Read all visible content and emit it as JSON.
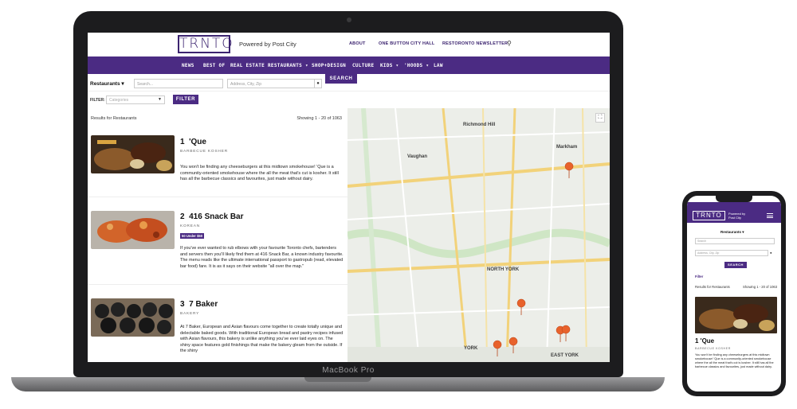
{
  "laptop_label": "MacBook Pro",
  "site": {
    "logo": "TRNTO",
    "powered_by": "Powered by Post City",
    "top_links": [
      "ABOUT",
      "ONE BUTTON CITY HALL",
      "RESTORONTO NEWSLETTER"
    ],
    "nav": [
      "NEWS",
      "BEST OF",
      "REAL ESTATE",
      "RESTAURANTS ▾",
      "SHOP+DESIGN",
      "CULTURE",
      "KIDS ▾",
      "'HOODS ▾",
      "LAW"
    ],
    "category_select": "Restaurants",
    "search_placeholder": "Search...",
    "address_placeholder": "Address, City, Zip",
    "search_button": "SEARCH",
    "filter_label": "FILTER:",
    "categories_placeholder": "Categories",
    "filter_button": "FILTER",
    "results_label": "Results for Restaurants",
    "showing": "Showing 1 - 20 of 1063",
    "listings": [
      {
        "rank": "1",
        "name": "'Que",
        "category": "BARBECUE KOSHER",
        "badge": "",
        "description": "You won't be finding any cheeseburgers at this midtown smokehouse! 'Que is a community-oriented smokehouse where the all the meat that's cut is kosher. It still has all the barbecue classics and favourites, just made without dairy."
      },
      {
        "rank": "2",
        "name": "416 Snack Bar",
        "category": "KOREAN",
        "badge": "50 Under $50",
        "description": "If you've ever wanted to rub elbows with your favourite Toronto chefs, bartenders and servers then you'll likely find them at 416 Snack Bar, a known industry favourite. The menu reads like the ultimate international passport to gastropub (read, elevated bar food) fare. It is as it says on their website \"all over the map.\""
      },
      {
        "rank": "3",
        "name": "7 Baker",
        "category": "BAKERY",
        "badge": "",
        "description": "At 7 Baker, European and Asian flavours come together to create totally unique and delectable baked goods. With traditional European bread and pastry recipes infused with Asian flavours, this bakery is unlike anything you've ever laid eyes on. The shiny space features gold finishings that make the bakery gleam from the outside. If the shiny"
      }
    ],
    "map_labels": [
      "Richmond Hill",
      "Markham",
      "Vaughan",
      "NORTH YORK",
      "YORK",
      "EAST YORK"
    ]
  },
  "phone": {
    "logo": "TRNTO",
    "powered_by": "Powered by Post City",
    "category_select": "Restaurants ▾",
    "search_placeholder": "Search",
    "address_placeholder": "Address, City, Zip",
    "search_button": "SEARCH",
    "filter_label": "Filter",
    "results_label": "Results for Restaurants",
    "showing": "Showing 1 - 20 of 1063",
    "listing_name": "1 'Que",
    "listing_category": "BARBECUE KOSHER",
    "listing_description": "You won't be finding any cheeseburgers at this midtown smokehouse! 'Que is a community-oriented smokehouse where the all the meat that's cut is kosher. It still has all the barbecue classics and favourites, just made without dairy."
  },
  "colors": {
    "brand": "#4b2b83",
    "marker": "#e8622c"
  },
  "icons": [
    "search-icon",
    "location-pin-icon",
    "fullscreen-icon",
    "map-marker-icon",
    "menu-icon"
  ]
}
